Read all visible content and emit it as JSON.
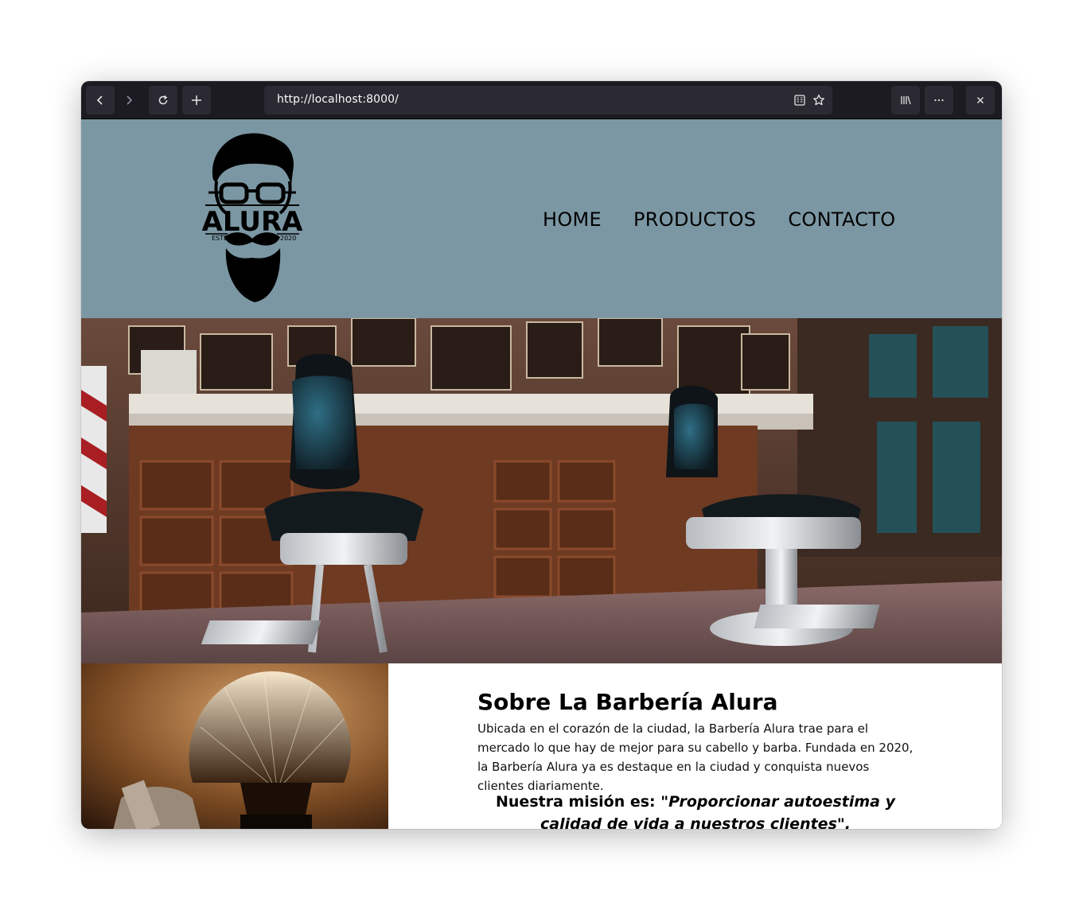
{
  "browser": {
    "url": "http://localhost:8000/"
  },
  "site": {
    "logo": {
      "brand": "ALURA",
      "estd_left": "ESTD",
      "estd_right": "2020"
    },
    "nav": [
      "HOME",
      "PRODUCTOS",
      "CONTACTO"
    ],
    "about": {
      "title": "Sobre La Barbería Alura",
      "text": "Ubicada en el corazón de la ciudad, la Barbería Alura trae para el mercado lo que hay de mejor para su cabello y barba. Fundada en 2020, la Barbería Alura ya es destaque en la ciudad y conquista nuevos clientes diariamente.",
      "mission_label": "Nuestra misión es: ",
      "mission_quote": "\"Proporcionar autoestima y calidad de vida a nuestros clientes\"."
    }
  }
}
